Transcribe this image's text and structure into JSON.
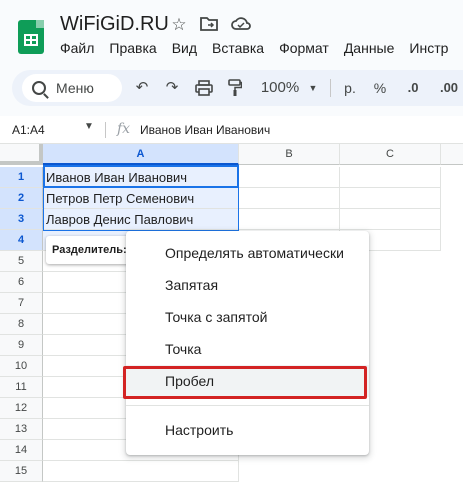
{
  "app": {
    "doc_title": "WiFiGiD.RU",
    "menus": [
      "Файл",
      "Правка",
      "Вид",
      "Вставка",
      "Формат",
      "Данные",
      "Инстр"
    ]
  },
  "toolbar": {
    "search_label": "Меню",
    "zoom": "100%",
    "currency": "р.",
    "percent": "%",
    "dec_decrease": ".0",
    "dec_increase": ".00"
  },
  "formula_bar": {
    "name_box": "A1:A4",
    "fx": "fx",
    "value": "Иванов Иван Иванович"
  },
  "sheet": {
    "columns": [
      "A",
      "B",
      "C"
    ],
    "rows": [
      "1",
      "2",
      "3",
      "4",
      "5",
      "6",
      "7",
      "8",
      "9",
      "10",
      "11",
      "12",
      "13",
      "14",
      "15"
    ],
    "cells": [
      "Иванов Иван Иванович",
      "Петров Петр Семенович",
      "Лавров Денис Павлович",
      ""
    ],
    "splitter_label": "Разделитель:"
  },
  "separator_menu": {
    "items": [
      "Определять автоматически",
      "Запятая",
      "Точка с запятой",
      "Точка",
      "Пробел"
    ],
    "custom": "Настроить",
    "highlighted_index": 4
  },
  "colors": {
    "selection": "#1a73e8",
    "highlight_frame": "#d32323",
    "sheets_green": "#0f9d58"
  }
}
